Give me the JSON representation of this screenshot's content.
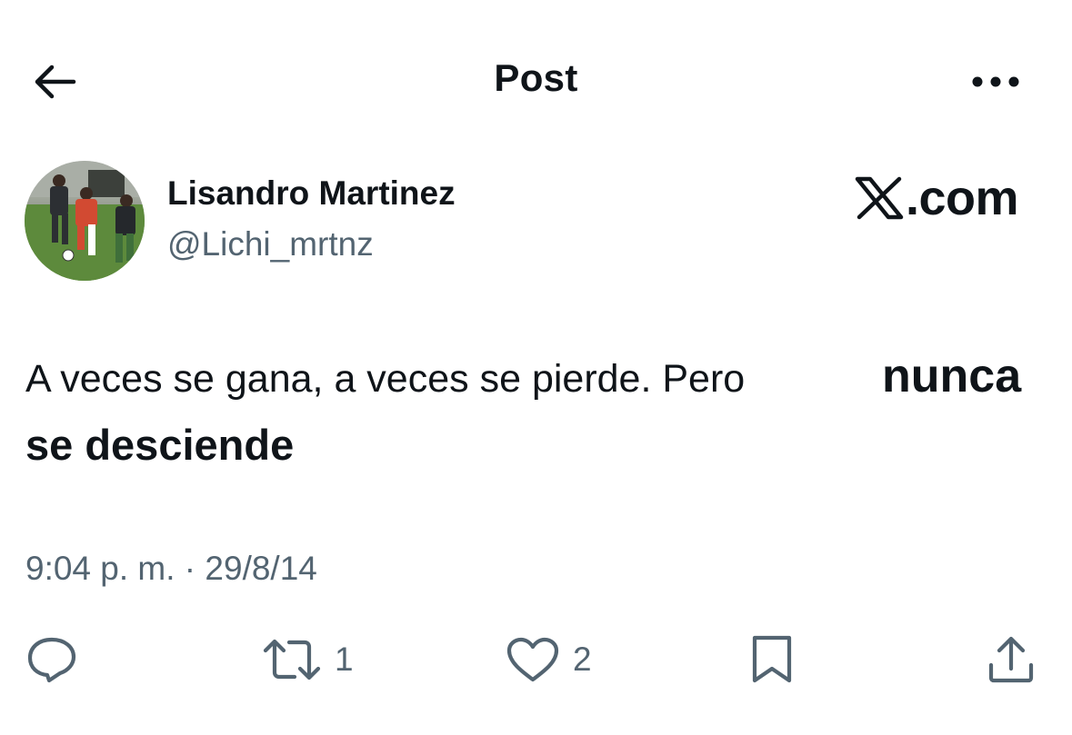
{
  "header": {
    "title": "Post",
    "back_icon": "arrow-left-icon",
    "more_icon": "more-horizontal-icon"
  },
  "author": {
    "name": "Lisandro Martinez",
    "handle": "@Lichi_mrtnz",
    "avatar": "avatar-photo"
  },
  "watermark": {
    "logo_text": "X",
    "text": ".com"
  },
  "tweet": {
    "line1": "A veces se gana, a veces se pierde. Pero",
    "bold1": "nunca",
    "line2": "se desciende"
  },
  "timestamp": "9:04 p. m. · 29/8/14",
  "actions": {
    "reply": {
      "icon": "reply-icon"
    },
    "repost": {
      "icon": "repost-icon",
      "count": "1"
    },
    "like": {
      "icon": "heart-icon",
      "count": "2"
    },
    "bookmark": {
      "icon": "bookmark-icon"
    },
    "share": {
      "icon": "share-icon"
    }
  },
  "colors": {
    "text": "#0f1419",
    "secondary": "#536471",
    "background": "#ffffff"
  }
}
